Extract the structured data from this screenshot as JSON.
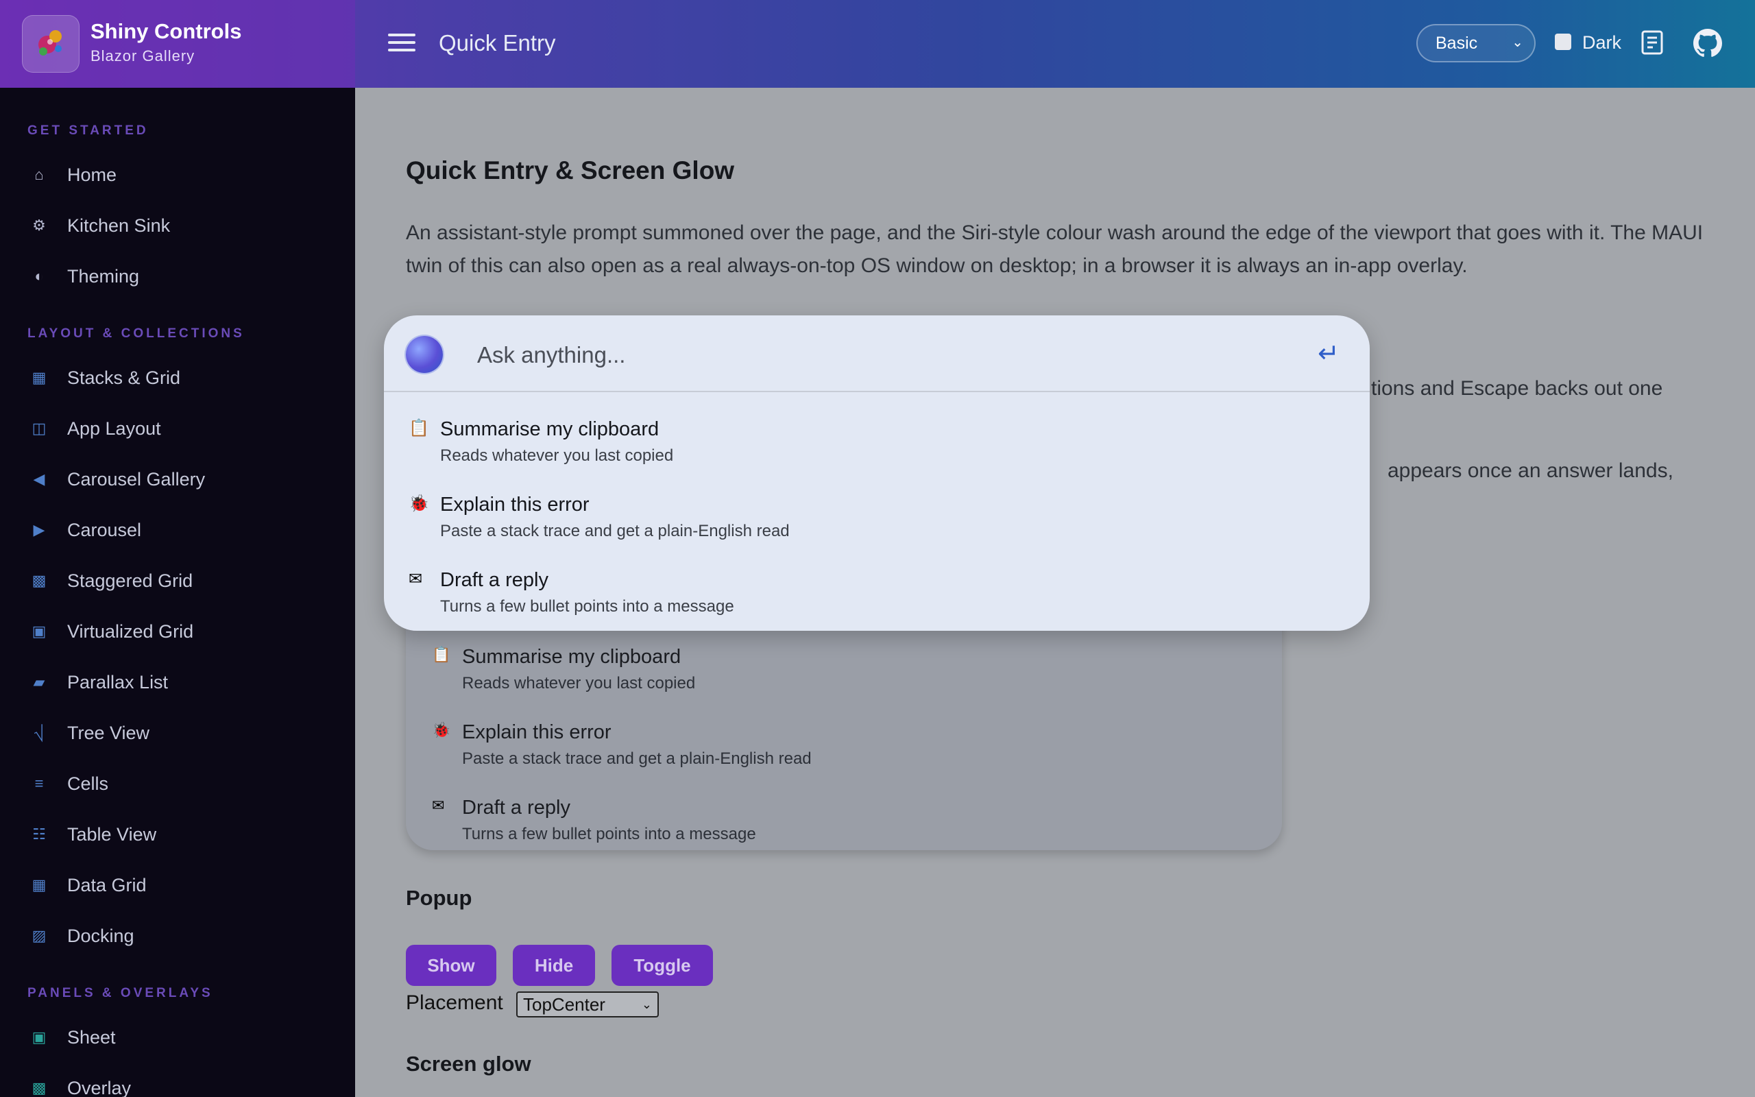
{
  "header": {
    "brand_title": "Shiny Controls",
    "brand_subtitle": "Blazor Gallery",
    "page_heading": "Quick Entry",
    "theme_select_value": "Basic",
    "dark_label": "Dark"
  },
  "sidebar": {
    "sections": [
      {
        "title": "GET STARTED"
      },
      {
        "title": "LAYOUT & COLLECTIONS"
      },
      {
        "title": "PANELS & OVERLAYS"
      }
    ],
    "items": [
      {
        "label": "Home",
        "icon": "⌂"
      },
      {
        "label": "Kitchen Sink",
        "icon": "⚙"
      },
      {
        "label": "Theming",
        "icon": "◐"
      },
      {
        "label": "Stacks & Grid",
        "icon": "▦"
      },
      {
        "label": "App Layout",
        "icon": "◫"
      },
      {
        "label": "Carousel Gallery",
        "icon": "◀"
      },
      {
        "label": "Carousel",
        "icon": "▶"
      },
      {
        "label": "Staggered Grid",
        "icon": "▩"
      },
      {
        "label": "Virtualized Grid",
        "icon": "▣"
      },
      {
        "label": "Parallax List",
        "icon": "▰"
      },
      {
        "label": "Tree View",
        "icon": "⎷"
      },
      {
        "label": "Cells",
        "icon": "≡"
      },
      {
        "label": "Table View",
        "icon": "☷"
      },
      {
        "label": "Data Grid",
        "icon": "▦"
      },
      {
        "label": "Docking",
        "icon": "▨"
      },
      {
        "label": "Sheet",
        "icon": "▣"
      },
      {
        "label": "Overlay",
        "icon": "▩"
      }
    ]
  },
  "main": {
    "title": "Quick Entry & Screen Glow",
    "description": "An assistant-style prompt summoned over the page, and the Siri-style colour wash around the edge of the viewport that goes with it. The MAUI twin of this can also open as a real always-on-top OS window on desktop; in a browser it is always an in-app overlay.",
    "peek_line1": "tions and Escape backs out one",
    "peek_line2": "appears once an answer lands,",
    "popup_title": "Popup",
    "buttons": {
      "show": "Show",
      "hide": "Hide",
      "toggle": "Toggle"
    },
    "placement_label": "Placement",
    "placement_value": "TopCenter",
    "glow_title": "Screen glow"
  },
  "suggestions": [
    {
      "icon": "📋",
      "title": "Summarise my clipboard",
      "subtitle": "Reads whatever you last copied"
    },
    {
      "icon": "🐞",
      "title": "Explain this error",
      "subtitle": "Paste a stack trace and get a plain-English read"
    },
    {
      "icon": "✉",
      "title": "Draft a reply",
      "subtitle": "Turns a few bullet points into a message"
    }
  ],
  "quick_entry": {
    "placeholder": "Ask anything...",
    "submit_icon": "↵"
  },
  "colors": {
    "accent": "#6a2fbf",
    "sidebar_bg": "#0b0816",
    "overlay_panel": "#e2e8f4",
    "section_label": "#6a4bb8"
  }
}
